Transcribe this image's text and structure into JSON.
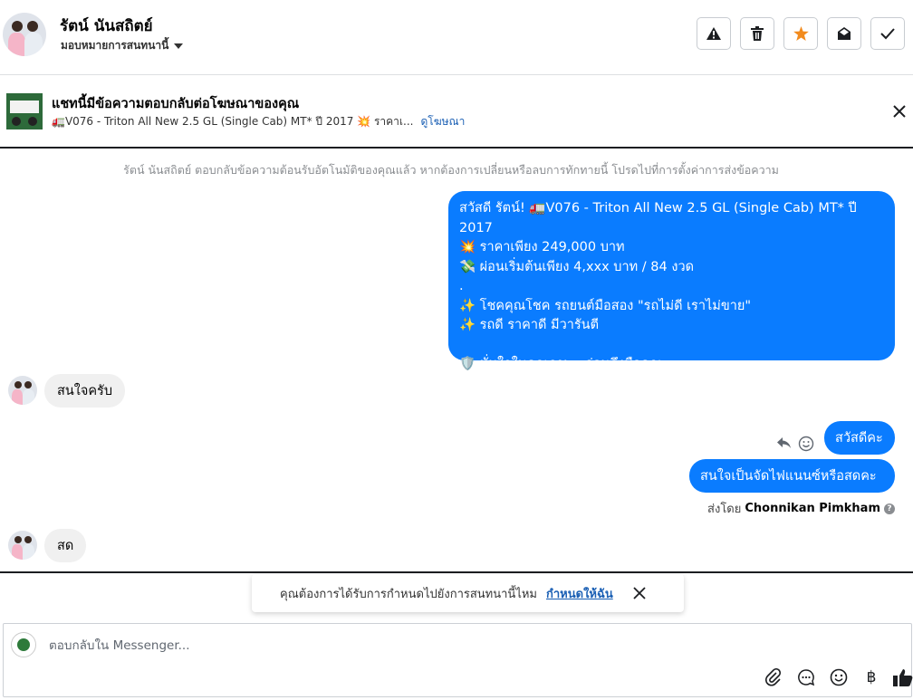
{
  "header": {
    "name": "รัตน์ นันสถิตย์",
    "assign_label": "มอบหมายการสนทนานี้",
    "actions": [
      {
        "id": "spam",
        "icon": "warning-icon"
      },
      {
        "id": "delete",
        "icon": "trash-icon"
      },
      {
        "id": "star",
        "icon": "star-icon",
        "color": "#f28b1e"
      },
      {
        "id": "mark-unread",
        "icon": "envelope-open-icon"
      },
      {
        "id": "done",
        "icon": "check-icon"
      }
    ]
  },
  "ad": {
    "title": "แชทนี้มีข้อความตอบกลับต่อโฆษณาของคุณ",
    "subtitle": "🚛V076 - Triton All New 2.5 GL (Single Cab) MT* ปี 2017 💥 ราคาเ...",
    "view_ad": "ดูโฆษณา"
  },
  "system_message": "รัตน์ นันสถิตย์ ตอบกลับข้อความต้อนรับอัตโนมัติของคุณแล้ว หากต้องการเปลี่ยนหรือลบการทักทายนี้ โปรดไปที่การตั้งค่าการส่งข้อความ",
  "messages": {
    "welcome": "สวัสดี รัตน์! 🚛V076 - Triton All New 2.5 GL (Single Cab) MT* ปี 2017\n💥 ราคาเพียง 249,000 บาท\n💸 ผ่อนเริ่มต้นเพียง 4,xxx บาท / 84 งวด\n.\n✨ โชคคุณโชค รถยนต์มือสอง \"รถไม่ดี เราไม่ขาย\"\n✨ รถดี ราคาดี มีวารันตี\n\n🛡️ มั่นใจในคุณภาพ...ก่อนถึงมือคุณ",
    "in1": "สนใจครับ",
    "out1": "สวัสดีคะ",
    "out2": "สนใจเป็นจัดไฟแนนซ์หรือสดคะ",
    "in2": "สด"
  },
  "sent_by": {
    "prefix": "ส่งโดย",
    "agent": "Chonnikan Pimkham",
    "help": "?"
  },
  "notice": {
    "text": "คุณต้องการได้รับการกำหนดไปยังการสนทนานี้ไหม",
    "link": "กำหนดให้ฉัน"
  },
  "composer": {
    "placeholder": "ตอบกลับใน Messenger...",
    "currency_symbol": "฿",
    "tools": [
      "paperclip-icon",
      "saved-replies-icon",
      "emoji-icon",
      "currency-icon",
      "thumbs-up-icon"
    ]
  },
  "colors": {
    "outgoing": "#0a7cff",
    "incoming": "#f0f0f0",
    "link": "#1a5fb4",
    "star": "#f28b1e"
  }
}
